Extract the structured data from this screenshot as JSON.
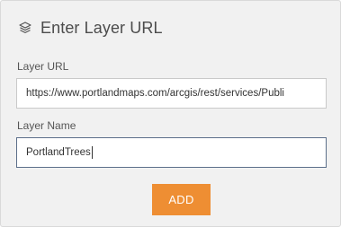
{
  "header": {
    "icon": "layers-icon",
    "title": "Enter Layer URL"
  },
  "fields": {
    "layer_url": {
      "label": "Layer URL",
      "value": "https://www.portlandmaps.com/arcgis/rest/services/Publi"
    },
    "layer_name": {
      "label": "Layer Name",
      "value": "PortlandTrees"
    }
  },
  "actions": {
    "add_label": "ADD"
  },
  "colors": {
    "panel_background": "#f1f1f1",
    "accent": "#ee8e33",
    "active_border": "#5c6f8a"
  }
}
